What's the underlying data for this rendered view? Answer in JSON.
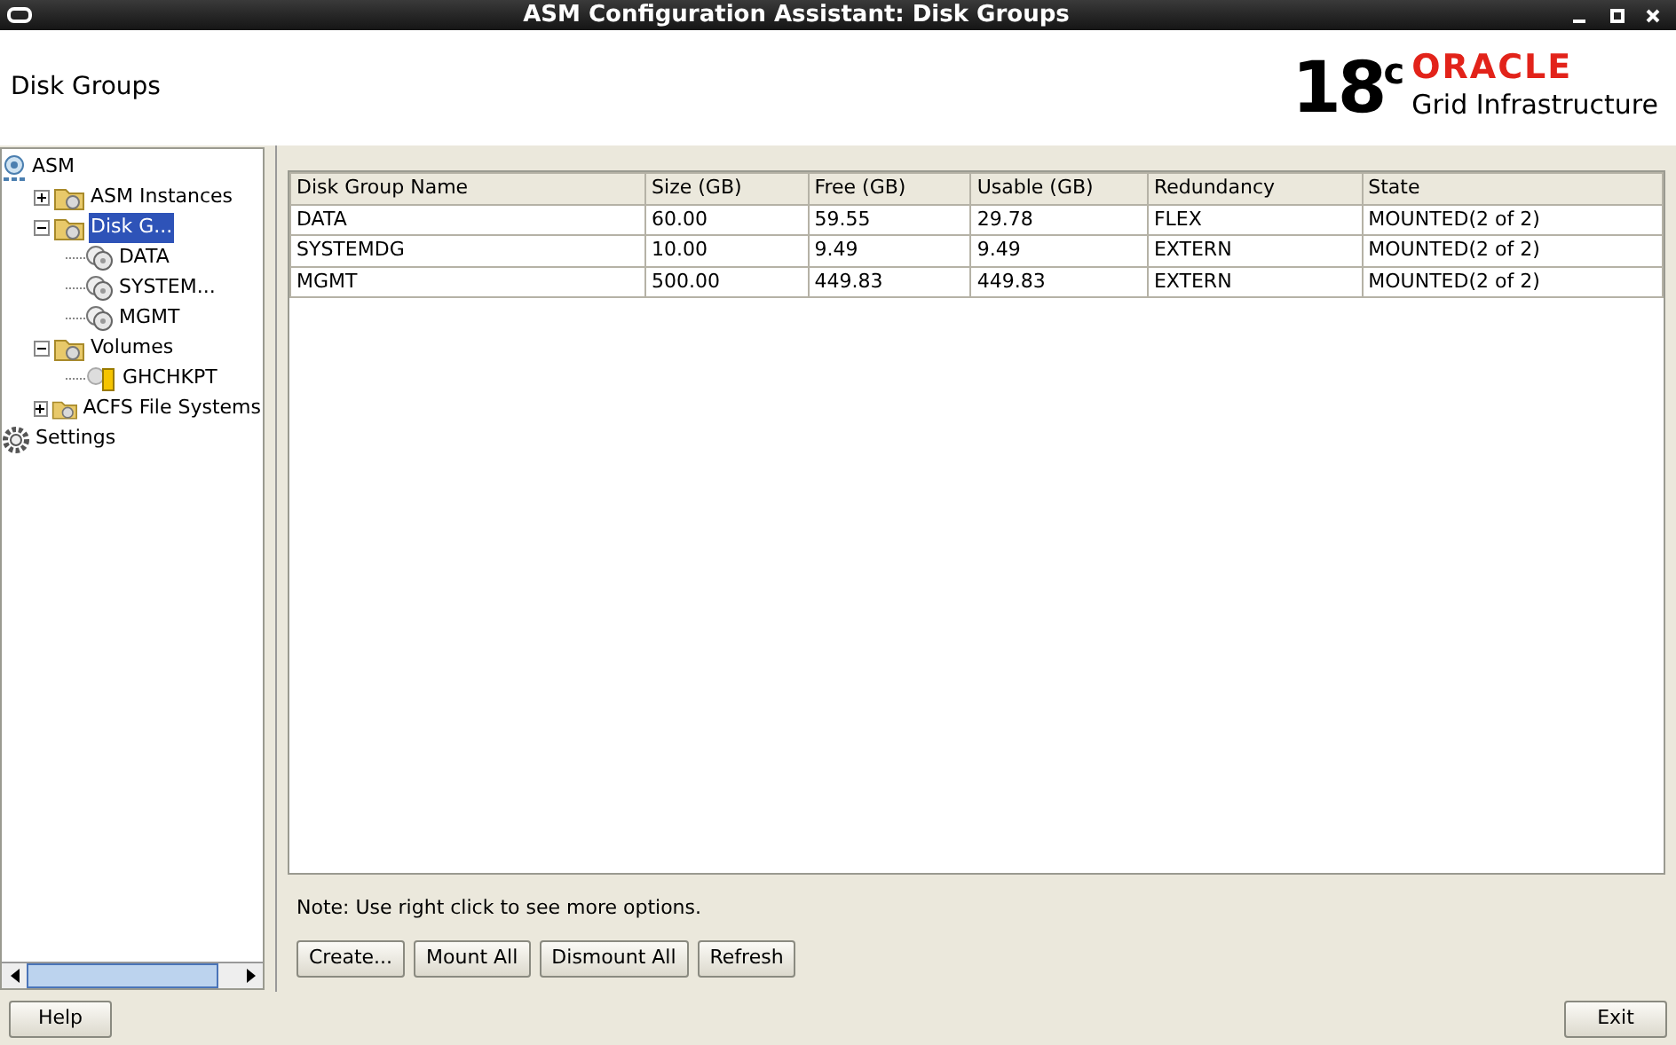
{
  "window": {
    "title": "ASM Configuration Assistant: Disk Groups"
  },
  "header": {
    "title": "Disk Groups",
    "logo": {
      "version": "18",
      "version_sup": "c",
      "brand": "ORACLE",
      "product": "Grid Infrastructure"
    }
  },
  "tree": [
    {
      "label": "ASM",
      "kind": "asm",
      "selected": false,
      "children": [
        {
          "label": "ASM Instances",
          "kind": "folder",
          "selected": false,
          "expanded": false
        },
        {
          "label": "Disk G...",
          "kind": "folder",
          "selected": true,
          "expanded": true,
          "children": [
            {
              "label": "DATA",
              "kind": "disk",
              "selected": false
            },
            {
              "label": "SYSTEM...",
              "kind": "disk",
              "selected": false
            },
            {
              "label": "MGMT",
              "kind": "disk",
              "selected": false
            }
          ]
        },
        {
          "label": "Volumes",
          "kind": "folder",
          "selected": false,
          "expanded": true,
          "children": [
            {
              "label": "GHCHKPT",
              "kind": "volume",
              "selected": false
            }
          ]
        },
        {
          "label": "ACFS File Systems",
          "kind": "folder",
          "selected": false,
          "expanded": false
        }
      ]
    },
    {
      "label": "Settings",
      "kind": "settings",
      "selected": false
    }
  ],
  "table": {
    "columns": [
      "Disk Group Name",
      "Size (GB)",
      "Free (GB)",
      "Usable (GB)",
      "Redundancy",
      "State"
    ],
    "rows": [
      [
        "DATA",
        "60.00",
        "59.55",
        "29.78",
        "FLEX",
        "MOUNTED(2 of 2)"
      ],
      [
        "SYSTEMDG",
        "10.00",
        "9.49",
        "9.49",
        "EXTERN",
        "MOUNTED(2 of 2)"
      ],
      [
        "MGMT",
        "500.00",
        "449.83",
        "449.83",
        "EXTERN",
        "MOUNTED(2 of 2)"
      ]
    ]
  },
  "note": "Note: Use right click to see more options.",
  "buttons": [
    "Create...",
    "Mount All",
    "Dismount All",
    "Refresh"
  ],
  "footer_buttons": [
    "Help",
    "Exit"
  ]
}
